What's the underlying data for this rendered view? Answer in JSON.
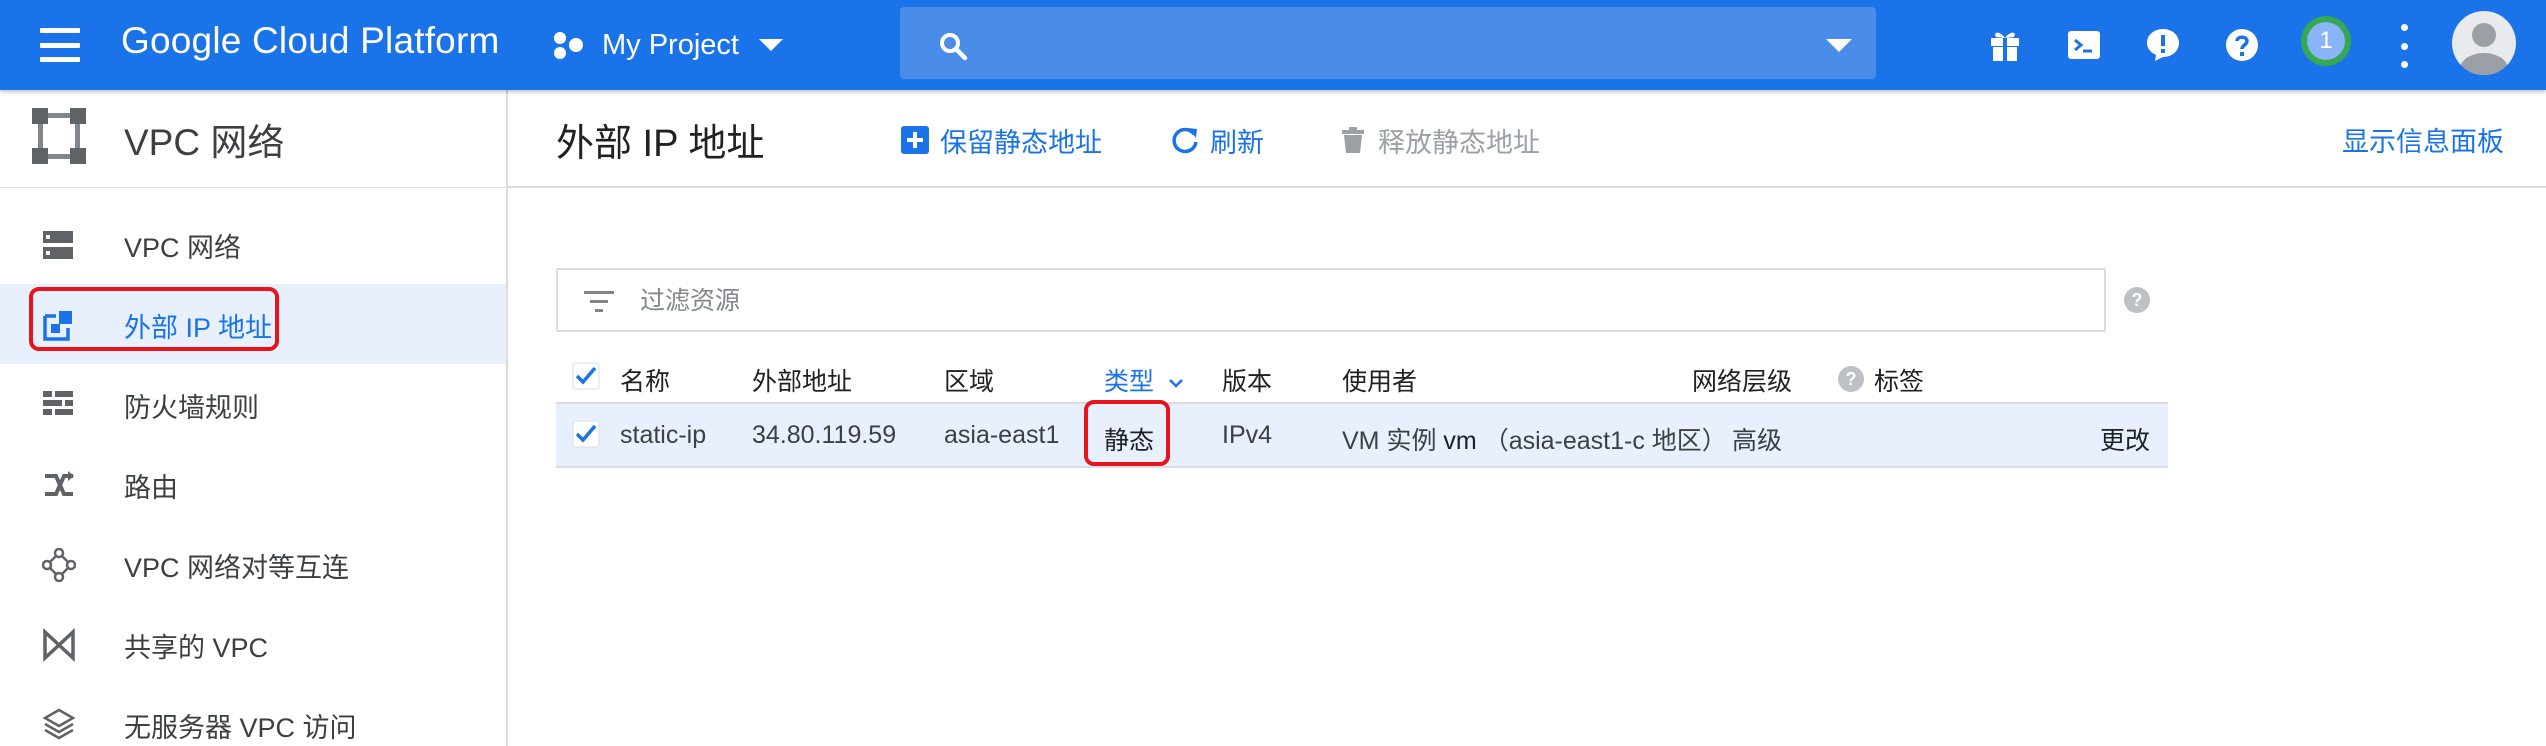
{
  "colors": {
    "brand_blue": "#1a73e8",
    "highlight_red": "#e8141c",
    "selected_row": "#e8f0fe"
  },
  "header": {
    "brand": "Google Cloud Platform",
    "project": "My Project",
    "search_placeholder": "",
    "notification_count": "1",
    "icons": [
      "menu-icon",
      "project-dots-icon",
      "search-icon",
      "gift-icon",
      "cloud-shell-icon",
      "notifications-icon",
      "help-icon",
      "more-vert-icon",
      "account-avatar-icon"
    ]
  },
  "sidebar": {
    "title": "VPC 网络",
    "items": [
      {
        "label": "VPC 网络",
        "icon": "vpc-network-icon"
      },
      {
        "label": "外部 IP 地址",
        "icon": "external-ip-icon",
        "active": true
      },
      {
        "label": "防火墙规则",
        "icon": "firewall-icon"
      },
      {
        "label": "路由",
        "icon": "routes-icon"
      },
      {
        "label": "VPC 网络对等互连",
        "icon": "peering-icon"
      },
      {
        "label": "共享的 VPC",
        "icon": "shared-vpc-icon"
      },
      {
        "label": "无服务器 VPC 访问",
        "icon": "serverless-vpc-icon"
      }
    ]
  },
  "main": {
    "title": "外部 IP 地址",
    "actions": {
      "reserve": "保留静态地址",
      "refresh": "刷新",
      "release": "释放静态地址"
    },
    "info_panel": "显示信息面板",
    "filter_placeholder": "过滤资源",
    "table": {
      "headers": {
        "name": "名称",
        "address": "外部地址",
        "region": "区域",
        "type": "类型",
        "version": "版本",
        "user": "使用者",
        "tier": "网络层级",
        "labels": "标签"
      },
      "rows": [
        {
          "name": "static-ip",
          "address": "34.80.119.59",
          "region": "asia-east1",
          "type": "静态",
          "version": "IPv4",
          "user_prefix": "VM 实例",
          "user_vm": "vm",
          "user_zone": "（asia-east1-c 地区）",
          "tier": "高级",
          "action": "更改"
        }
      ]
    }
  }
}
